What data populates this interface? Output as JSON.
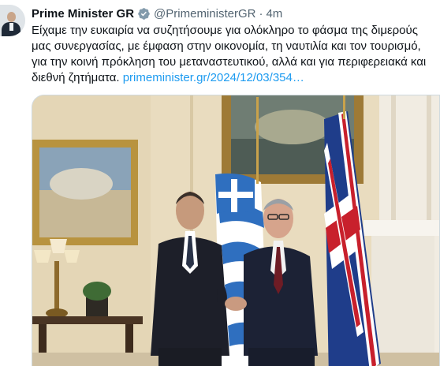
{
  "tweet": {
    "author_name": "Prime Minister GR",
    "handle": "@PrimeministerGR",
    "separator": "·",
    "time": "4m",
    "text_lines": [
      "Είχαμε την ευκαιρία να συζητήσουμε για ολόκληρο το φάσμα της διμερούς",
      "μας συνεργασίας, με έμφαση στην οικονομία, τη ναυτιλία και τον τουρισμό,",
      "για την κοινή πρόκληση του μεταναστευτικού, αλλά και για περιφερειακά και"
    ],
    "last_line_text": "διεθνή ζητήματα. ",
    "link_text": "primeminister.gr/2024/12/03/354…",
    "icons": {
      "avatar": "profile-avatar",
      "verified": "verified-badge-icon"
    },
    "colors": {
      "link": "#1d9bf0",
      "verified": "#829aab",
      "text": "#0f1419",
      "secondary": "#536471"
    }
  }
}
